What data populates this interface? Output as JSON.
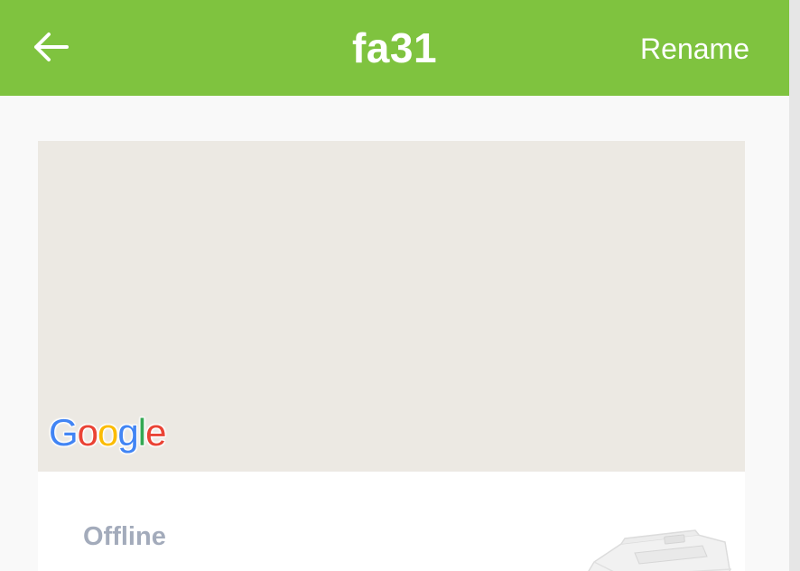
{
  "header": {
    "title": "fa31",
    "rename_label": "Rename",
    "background_color": "#7fc33f",
    "back_icon": "arrow-left-icon"
  },
  "map": {
    "background_color": "#ece9e3",
    "attribution": {
      "letters": [
        "G",
        "o",
        "o",
        "g",
        "l",
        "e"
      ],
      "colors": [
        "#4285f4",
        "#ea4335",
        "#fbbc05",
        "#4285f4",
        "#34a853",
        "#ea4335"
      ]
    }
  },
  "device": {
    "status": "Offline",
    "status_color": "#a3abbb",
    "image_icon": "device-battery-image"
  }
}
